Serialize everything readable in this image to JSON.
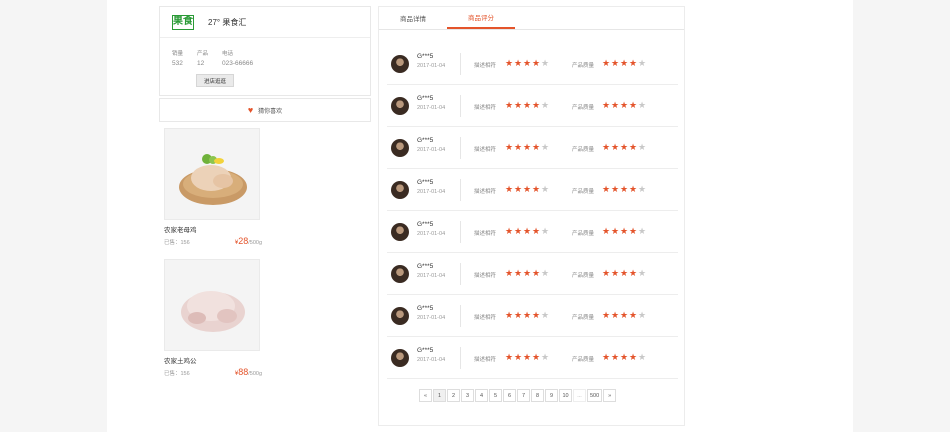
{
  "shop": {
    "logo_text": "果食",
    "name": "27° 果食汇",
    "stats": [
      {
        "label": "销量",
        "value": "532"
      },
      {
        "label": "产品",
        "value": "12"
      },
      {
        "label": "电话",
        "value": "023-66666"
      }
    ],
    "visit_button": "进店逛逛"
  },
  "guess": {
    "label": "猜你喜欢"
  },
  "products": [
    {
      "name": "农家老母鸡",
      "sold": "已售：156",
      "currency": "¥",
      "price": "28",
      "unit": "/500g"
    },
    {
      "name": "农家土鸡公",
      "sold": "已售：156",
      "currency": "¥",
      "price": "88",
      "unit": "/500g"
    }
  ],
  "tabs": [
    {
      "label": "商品详情",
      "active": false
    },
    {
      "label": "商品评分",
      "active": true
    }
  ],
  "review_labels": {
    "desc": "描述相符",
    "quality": "产品质量"
  },
  "reviews": [
    {
      "user": "G***5",
      "date": "2017-01-04",
      "desc_rating": 4,
      "quality_rating": 4
    },
    {
      "user": "G***5",
      "date": "2017-01-04",
      "desc_rating": 4,
      "quality_rating": 4
    },
    {
      "user": "G***5",
      "date": "2017-01-04",
      "desc_rating": 4,
      "quality_rating": 4
    },
    {
      "user": "G***5",
      "date": "2017-01-04",
      "desc_rating": 4,
      "quality_rating": 4
    },
    {
      "user": "G***5",
      "date": "2017-01-04",
      "desc_rating": 4,
      "quality_rating": 4
    },
    {
      "user": "G***5",
      "date": "2017-01-04",
      "desc_rating": 4,
      "quality_rating": 4
    },
    {
      "user": "G***5",
      "date": "2017-01-04",
      "desc_rating": 4,
      "quality_rating": 4
    },
    {
      "user": "G***5",
      "date": "2017-01-04",
      "desc_rating": 4,
      "quality_rating": 4
    }
  ],
  "pagination": [
    "«",
    "1",
    "2",
    "3",
    "4",
    "5",
    "6",
    "7",
    "8",
    "9",
    "10",
    "...",
    "500",
    "»"
  ],
  "pagination_current": "1",
  "colors": {
    "accent": "#e4542b",
    "brand_green": "#2a9a36"
  }
}
